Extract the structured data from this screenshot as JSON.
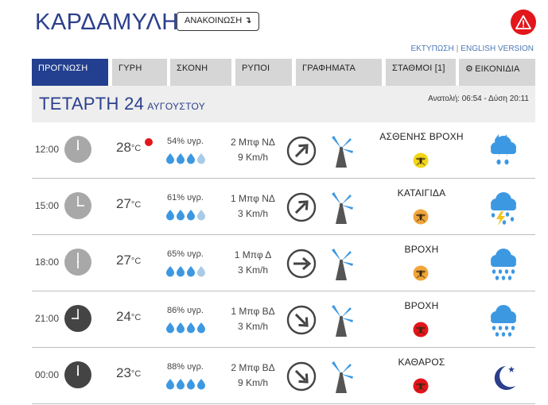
{
  "header": {
    "town": "ΚΑΡΔΑΜΥΛΗ",
    "announce_label": "ΑΝΑΚΟΙΝΩΣΗ",
    "announce_arrow": "↴",
    "print_link": "ΕΚΤΥΠΩΣΗ",
    "separator": "|",
    "english_link": "ENGLISH VERSION"
  },
  "tabs": [
    {
      "label": "ΠΡΟΓΝΩΣΗ",
      "active": true
    },
    {
      "label": "ΓΥΡΗ"
    },
    {
      "label": "ΣΚΟΝΗ"
    },
    {
      "label": "ΡΥΠΟΙ"
    },
    {
      "label": "ΓΡΑΦΗΜΑΤΑ"
    },
    {
      "label": "ΣΤΑΘΜΟΙ [1]"
    },
    {
      "label": "ΕΙΚΟΝΙΔΙΑ",
      "icon": "gear-icon"
    }
  ],
  "date": {
    "day": "ΤΕΤΑΡΤΗ 24",
    "month": "ΑΥΓΟΥΣΤΟΥ",
    "sun": "Ανατολή: 06:54  - Δύση 20:11"
  },
  "colors": {
    "brand_blue": "#233f8f",
    "title_blue": "#2b3f8c",
    "alert_red": "#e3161b",
    "drop_blue": "#3d98e2",
    "drop_light": "#a9cbe8",
    "clock_day": "#a8a8a8",
    "clock_night": "#444444",
    "badge_yellow": "#f2d61a",
    "badge_orange": "#f0a53a",
    "badge_red": "#e3161b"
  },
  "forecast": [
    {
      "time": "12:00",
      "hour": 12,
      "clock": "day",
      "temp": "28",
      "unit": "°C",
      "hot": true,
      "humidity": "54% υγρ.",
      "drops": 3,
      "wind_bf": "2 Μπφ ΝΔ",
      "wind_kmh": "9 Km/h",
      "wind_dir": "NE",
      "condition": "ΑΣΘΕΝΗΣ ΒΡΟΧΗ",
      "badge": "yellow",
      "weather_icon": "rain-cloud-icon"
    },
    {
      "time": "15:00",
      "hour": 15,
      "clock": "day",
      "temp": "27",
      "unit": "°C",
      "hot": false,
      "humidity": "61% υγρ.",
      "drops": 3,
      "wind_bf": "1 Μπφ ΝΔ",
      "wind_kmh": "3 Km/h",
      "wind_dir": "NE",
      "condition": "ΚΑΤΑΙΓΙΔΑ",
      "badge": "orange",
      "weather_icon": "thunderstorm-icon"
    },
    {
      "time": "18:00",
      "hour": 18,
      "clock": "day",
      "temp": "27",
      "unit": "°C",
      "hot": false,
      "humidity": "65% υγρ.",
      "drops": 3,
      "wind_bf": "1 Μπφ Δ",
      "wind_kmh": "3 Km/h",
      "wind_dir": "E",
      "condition": "ΒΡΟΧΗ",
      "badge": "orange",
      "weather_icon": "heavy-rain-icon"
    },
    {
      "time": "21:00",
      "hour": 21,
      "clock": "night",
      "temp": "24",
      "unit": "°C",
      "hot": false,
      "humidity": "86% υγρ.",
      "drops": 4,
      "wind_bf": "1 Μπφ ΒΔ",
      "wind_kmh": "3 Km/h",
      "wind_dir": "SE",
      "condition": "ΒΡΟΧΗ",
      "badge": "red",
      "weather_icon": "heavy-rain-icon"
    },
    {
      "time": "00:00",
      "hour": 0,
      "clock": "night",
      "temp": "23",
      "unit": "°C",
      "hot": false,
      "humidity": "88% υγρ.",
      "drops": 4,
      "wind_bf": "2 Μπφ ΒΔ",
      "wind_kmh": "9 Km/h",
      "wind_dir": "SE",
      "condition": "ΚΑΘΑΡΟΣ",
      "badge": "red",
      "weather_icon": "moon-icon"
    }
  ]
}
